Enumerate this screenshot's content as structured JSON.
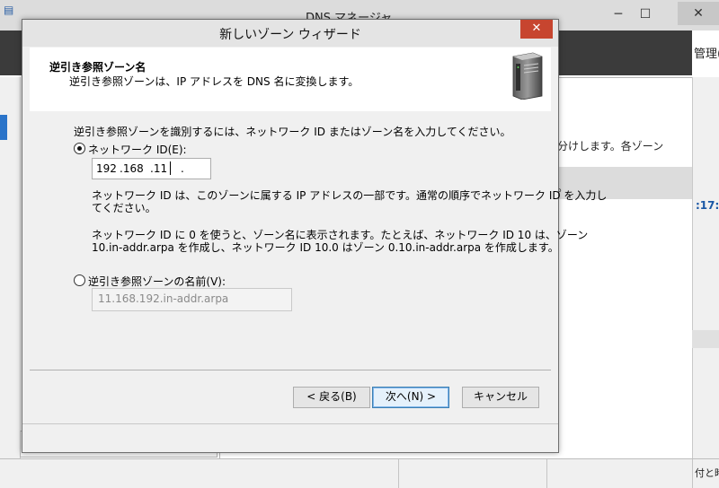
{
  "background_window": {
    "title": "DNS マネージャ",
    "right_header_text": "管理(",
    "main_text_1": "分けします。各ゾーン",
    "main_text_2": "。",
    "time_fragment": ":17:",
    "status_right_text": "付と時"
  },
  "dialog": {
    "title": "新しいゾーン ウィザード",
    "close_symbol": "✕",
    "header": {
      "title": "逆引き参照ゾーン名",
      "subtitle": "逆引き参照ゾーンは、IP アドレスを DNS 名に変換します。"
    },
    "instruction": "逆引き参照ゾーンを識別するには、ネットワーク ID またはゾーン名を入力してください。",
    "network_id_option": {
      "label": "ネットワーク ID(E):",
      "selected": true,
      "ip_segments": [
        "192",
        ".168",
        ".11",
        "."
      ]
    },
    "network_id_help_1": "ネットワーク ID は、このゾーンに属する IP アドレスの一部です。通常の順序でネットワーク ID を入力し",
    "network_id_help_1b": "てください。",
    "network_id_help_2": "ネットワーク ID に 0 を使うと、ゾーン名に表示されます。たとえば、ネットワーク ID 10 は、ゾーン",
    "network_id_help_2b": "10.in-addr.arpa を作成し、ネットワーク ID 10.0 はゾーン 0.10.in-addr.arpa を作成します。",
    "zone_name_option": {
      "label": "逆引き参照ゾーンの名前(V):",
      "selected": false,
      "value": "11.168.192.in-addr.arpa"
    },
    "buttons": {
      "back": "< 戻る(B)",
      "next": "次へ(N) >",
      "cancel": "キャンセル"
    }
  },
  "colors": {
    "close_button": "#c7452f",
    "primary_button_border": "#3c7fb1",
    "selection_blue": "#2b74c9"
  }
}
